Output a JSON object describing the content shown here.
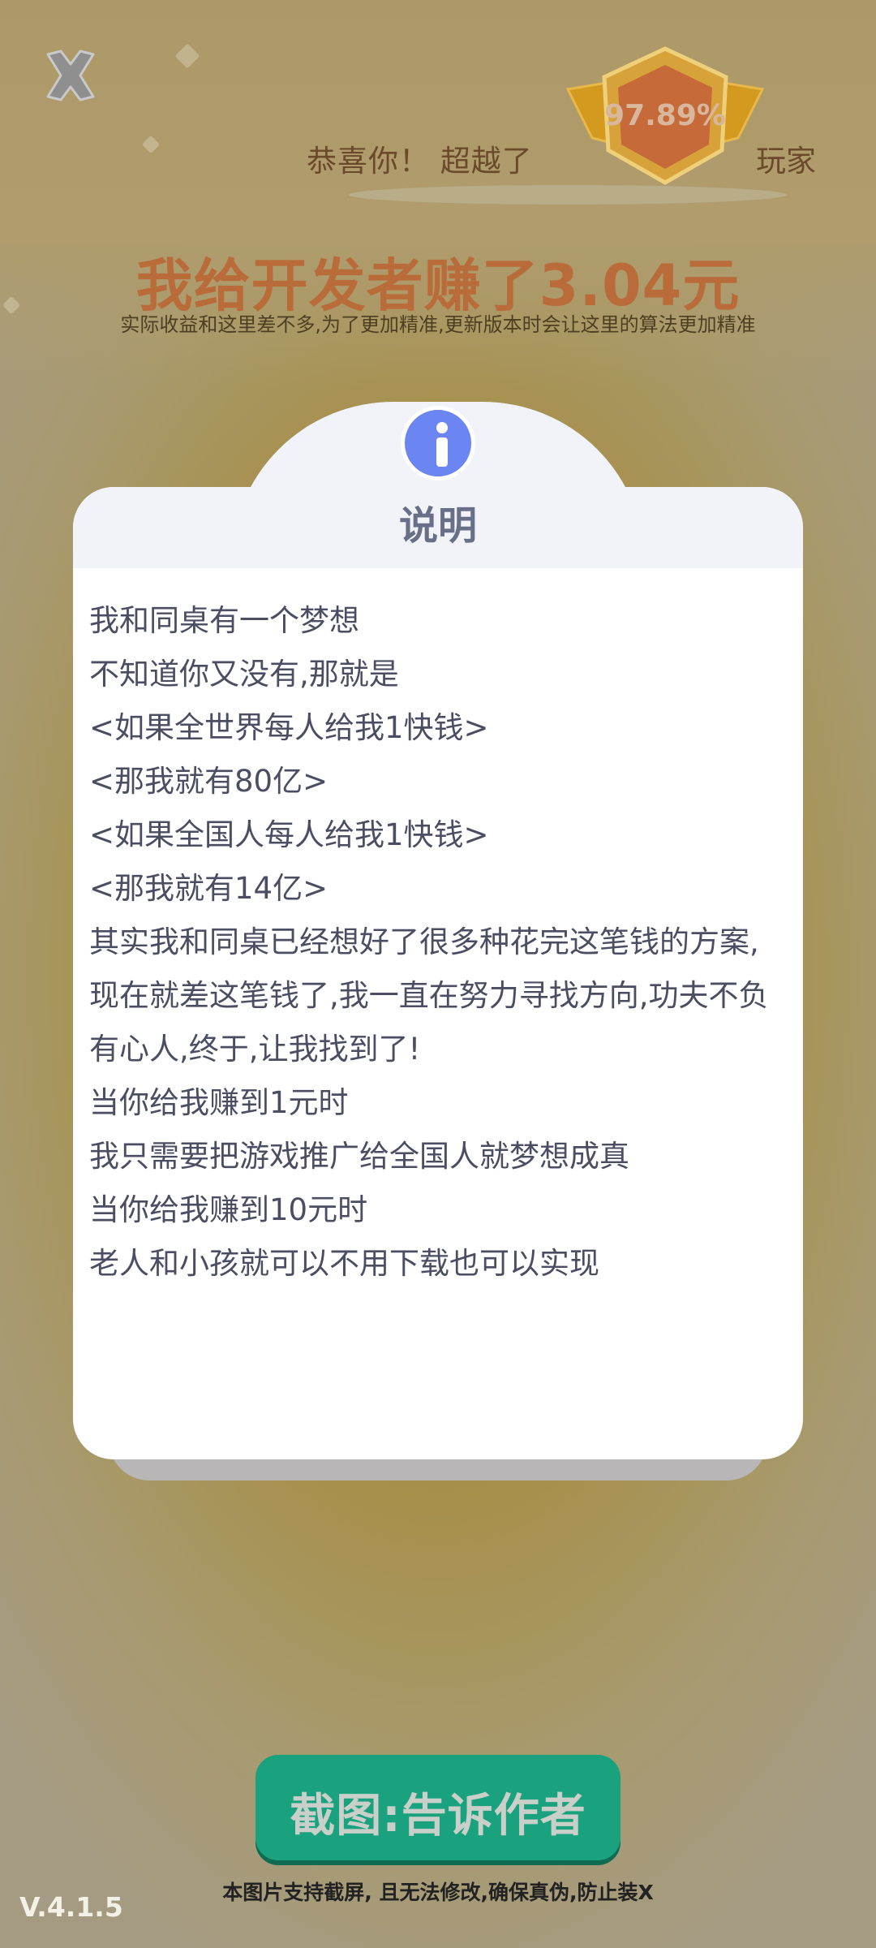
{
  "header": {
    "congrats_left": "恭喜你！ 超越了",
    "congrats_right": "玩家",
    "badge_percent": "97.89%"
  },
  "earnings": {
    "title": "我给开发者赚了3.04元",
    "subtitle": "实际收益和这里差不多,为了更加精准,更新版本时会让这里的算法更加精准"
  },
  "dialog": {
    "title": "说明",
    "icon": "info-icon",
    "lines": [
      "我和同桌有一个梦想",
      "不知道你又没有,那就是",
      "<如果全世界每人给我1快钱>",
      "<那我就有80亿>",
      "<如果全国人每人给我1快钱>",
      "<那我就有14亿>",
      "其实我和同桌已经想好了很多种花完这笔钱的方案,",
      "现在就差这笔钱了,我一直在努力寻找方向,功夫不负",
      "有心人,终于,让我找到了!",
      "当你给我赚到1元时",
      "我只需要把游戏推广给全国人就梦想成真",
      "当你给我赚到10元时",
      "老人和小孩就可以不用下载也可以实现"
    ]
  },
  "share_button": "截图:告诉作者",
  "footer_note": "本图片支持截屏, 且无法修改,确保真伪,防止装X",
  "version": "V.4.1.5",
  "colors": {
    "accent_green": "#1aa27e",
    "title_orange": "#b96c3a",
    "info_blue": "#6b86f2"
  }
}
